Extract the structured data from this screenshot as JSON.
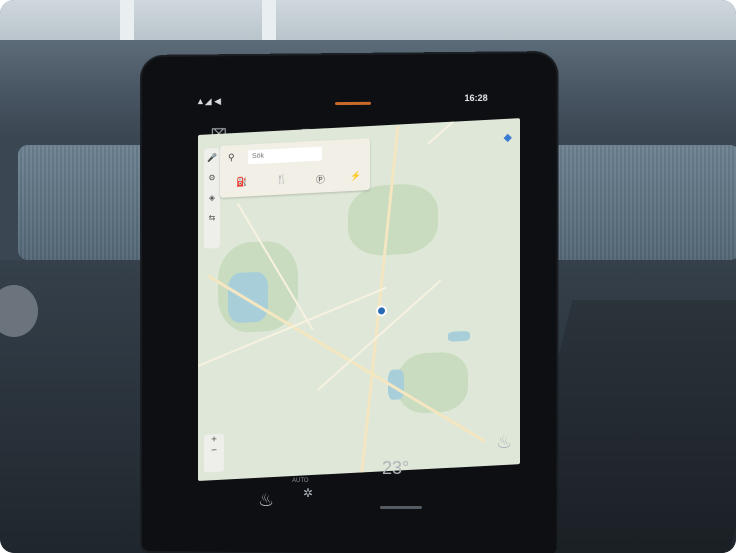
{
  "status_bar": {
    "signal": "▲◢ ◀",
    "time": "16:28"
  },
  "top_icons": [
    "camera-icon",
    "car-icon",
    "app-grid-icon",
    "profile-icon"
  ],
  "map": {
    "search_placeholder": "Sök",
    "category_icons": [
      "fuel-icon",
      "food-icon",
      "parking-icon",
      "charging-icon"
    ],
    "side_controls": [
      "mic-icon",
      "settings-icon",
      "layers-icon",
      "route-icon"
    ],
    "zoom": {
      "in": "+",
      "out": "−"
    }
  },
  "climate": {
    "temperature": "23°",
    "fan_label": "AUTO",
    "fan_icon": "fan-icon"
  },
  "colors": {
    "map_bg": "#dfe8d8",
    "accent_notch": "#c86a2a"
  }
}
